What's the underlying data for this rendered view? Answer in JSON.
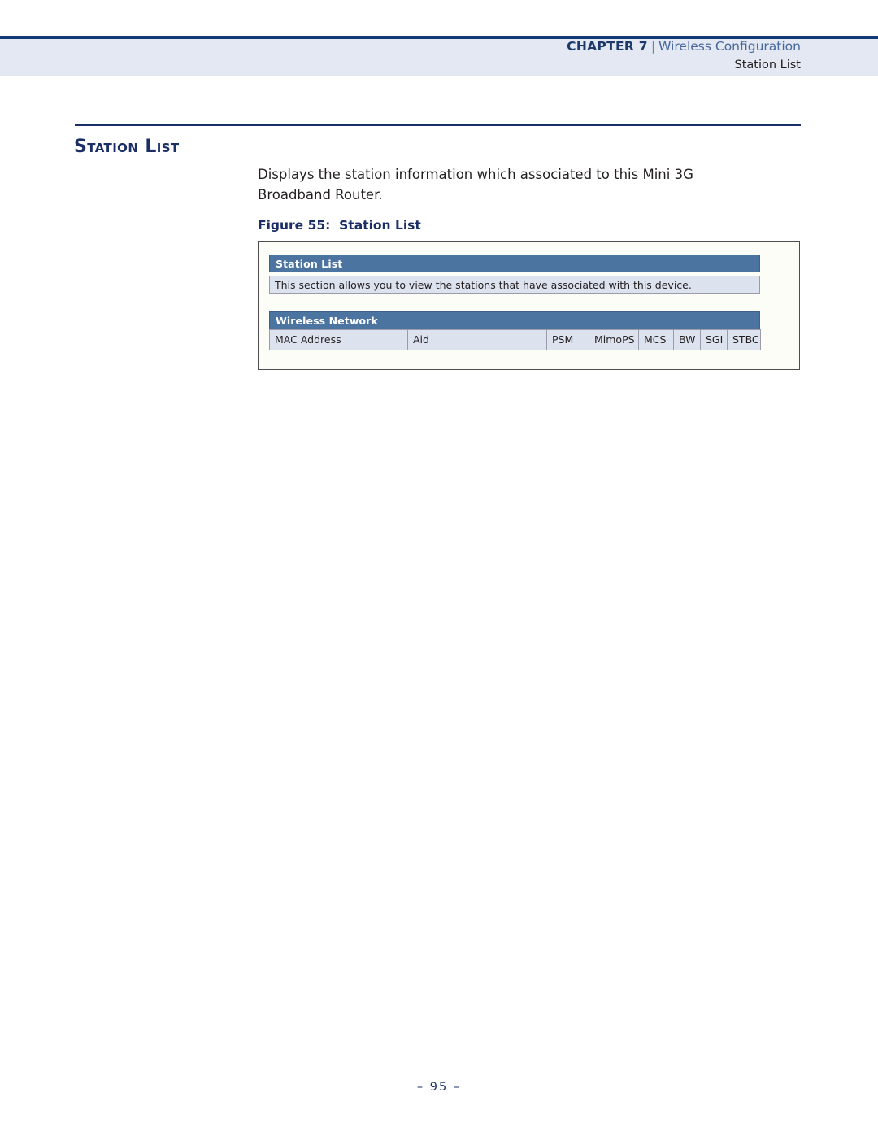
{
  "header": {
    "chapter_label": "CHAPTER 7",
    "separator": "|",
    "chapter_topic": "Wireless Configuration",
    "subsection": "Station List"
  },
  "section": {
    "title": "Station List",
    "body": "Displays the station information which associated to this Mini 3G Broadband Router.",
    "figure_caption": "Figure 55:  Station List"
  },
  "figure": {
    "panel_title": "Station List",
    "panel_description": "This section allows you to view the stations that have associated with this device.",
    "table_title": "Wireless Network",
    "columns": [
      "MAC Address",
      "Aid",
      "PSM",
      "MimoPS",
      "MCS",
      "BW",
      "SGI",
      "STBC"
    ],
    "rows": []
  },
  "footer": {
    "page_number": "–  95  –"
  },
  "colors": {
    "navy": "#1b2f66",
    "header_band": "#e4e8f2",
    "link_blue": "#46689c",
    "ui_bar": "#4c74a0",
    "ui_cell": "#dde2ef"
  }
}
